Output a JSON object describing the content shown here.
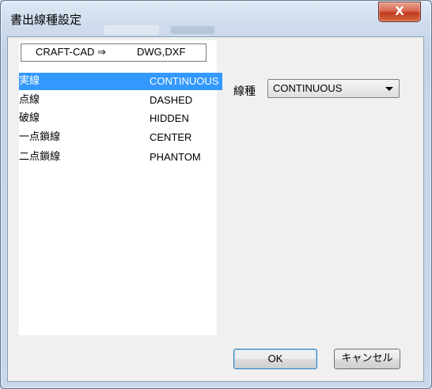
{
  "window": {
    "title": "書出線種設定",
    "close_label": "X"
  },
  "list": {
    "header_left": "CRAFT-CAD ⇒",
    "header_right": "DWG,DXF",
    "selected_index": 0,
    "items": [
      {
        "jp": "実線",
        "en": "CONTINUOUS"
      },
      {
        "jp": "点線",
        "en": "DASHED"
      },
      {
        "jp": "破線",
        "en": "HIDDEN"
      },
      {
        "jp": "一点鎖線",
        "en": "CENTER"
      },
      {
        "jp": "二点鎖線",
        "en": "PHANTOM"
      }
    ]
  },
  "linetype": {
    "label": "線種",
    "value": "CONTINUOUS"
  },
  "buttons": {
    "ok": "OK",
    "cancel": "キャンセル"
  },
  "colors": {
    "selection": "#3399ff",
    "close_button": "#c23a20"
  }
}
